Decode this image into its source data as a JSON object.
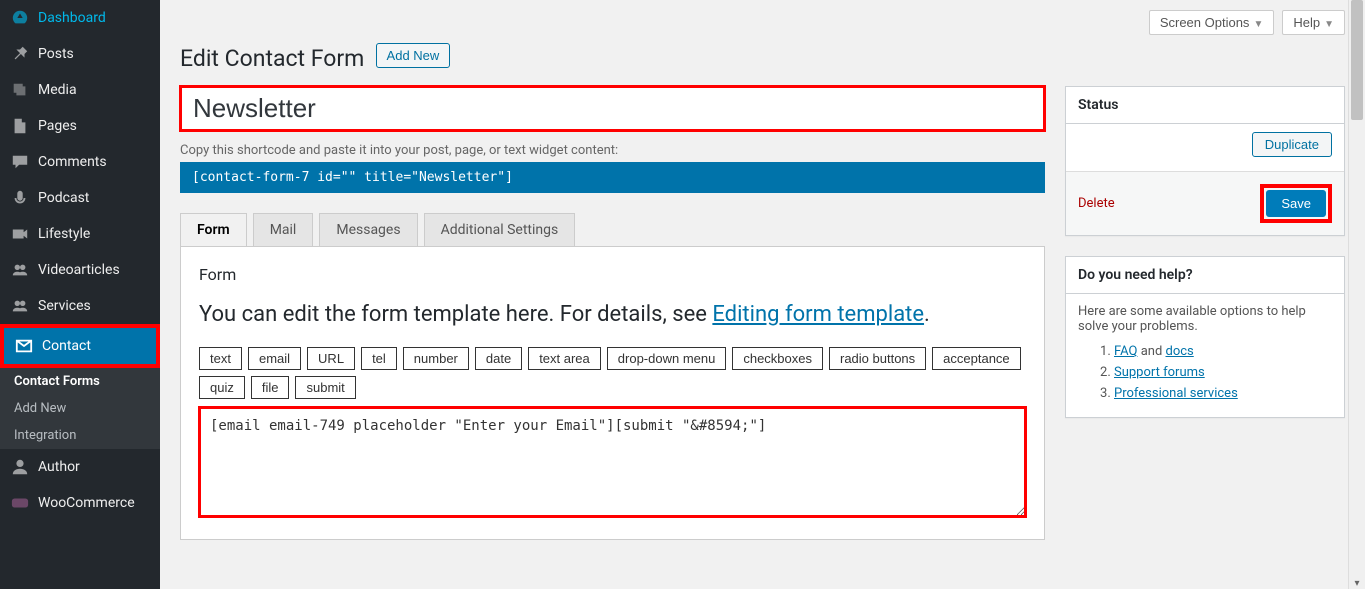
{
  "topbar": {
    "screen_options": "Screen Options",
    "help": "Help"
  },
  "page": {
    "title": "Edit Contact Form",
    "add_new": "Add New"
  },
  "form": {
    "title_value": "Newsletter",
    "shortcode_hint": "Copy this shortcode and paste it into your post, page, or text widget content:",
    "shortcode": "[contact-form-7 id=\"\" title=\"Newsletter\"]"
  },
  "tabs": {
    "form": "Form",
    "mail": "Mail",
    "messages": "Messages",
    "additional": "Additional Settings"
  },
  "panel": {
    "heading": "Form",
    "para_prefix": "You can edit the form template here. For details, see ",
    "para_link": "Editing form template",
    "para_suffix": ".",
    "tags": [
      "text",
      "email",
      "URL",
      "tel",
      "number",
      "date",
      "text area",
      "drop-down menu",
      "checkboxes",
      "radio buttons",
      "acceptance",
      "quiz",
      "file",
      "submit"
    ],
    "textarea_value": "[email email-749 placeholder \"Enter your Email\"][submit \"&#8594;\"]"
  },
  "status_box": {
    "title": "Status",
    "duplicate": "Duplicate",
    "delete": "Delete",
    "save": "Save"
  },
  "help_box": {
    "title": "Do you need help?",
    "intro": "Here are some available options to help solve your problems.",
    "item1_link": "FAQ",
    "item1_mid": " and ",
    "item1_link2": "docs",
    "item2": "Support forums",
    "item3": "Professional services"
  },
  "sidebar": {
    "items": [
      {
        "label": "Dashboard",
        "icon": "gauge"
      },
      {
        "label": "Posts",
        "icon": "pin"
      },
      {
        "label": "Media",
        "icon": "media"
      },
      {
        "label": "Pages",
        "icon": "page"
      },
      {
        "label": "Comments",
        "icon": "comment"
      },
      {
        "label": "Podcast",
        "icon": "mic"
      },
      {
        "label": "Lifestyle",
        "icon": "video"
      },
      {
        "label": "Videoarticles",
        "icon": "users"
      },
      {
        "label": "Services",
        "icon": "users"
      },
      {
        "label": "Contact",
        "icon": "mail",
        "active": true
      },
      {
        "label": "Author",
        "icon": "user"
      },
      {
        "label": "WooCommerce",
        "icon": "woo"
      }
    ],
    "submenu": [
      "Contact Forms",
      "Add New",
      "Integration"
    ]
  }
}
